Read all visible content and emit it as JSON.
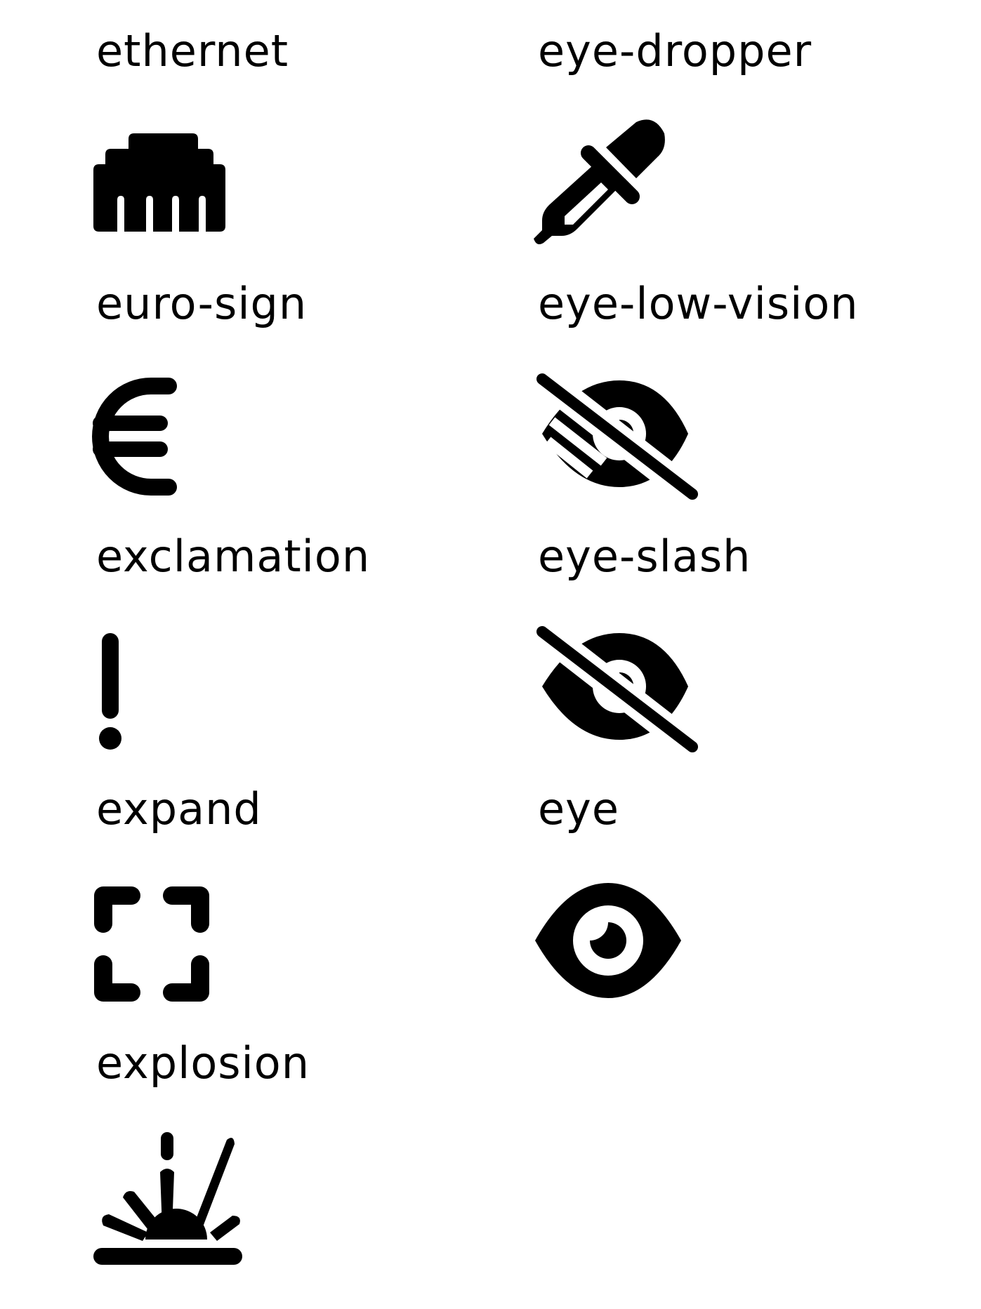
{
  "icons": {
    "ethernet": {
      "label": "ethernet",
      "icon_name": "ethernet-icon"
    },
    "euro_sign": {
      "label": "euro-sign",
      "icon_name": "euro-sign-icon"
    },
    "exclamation": {
      "label": "exclamation",
      "icon_name": "exclamation-icon"
    },
    "expand": {
      "label": "expand",
      "icon_name": "expand-icon"
    },
    "explosion": {
      "label": "explosion",
      "icon_name": "explosion-icon"
    },
    "eye_dropper": {
      "label": "eye-dropper",
      "icon_name": "eye-dropper-icon"
    },
    "eye_low_vision": {
      "label": "eye-low-vision",
      "icon_name": "eye-low-vision-icon"
    },
    "eye_slash": {
      "label": "eye-slash",
      "icon_name": "eye-slash-icon"
    },
    "eye": {
      "label": "eye",
      "icon_name": "eye-icon"
    }
  },
  "colors": {
    "foreground": "#000000",
    "background": "#ffffff"
  }
}
